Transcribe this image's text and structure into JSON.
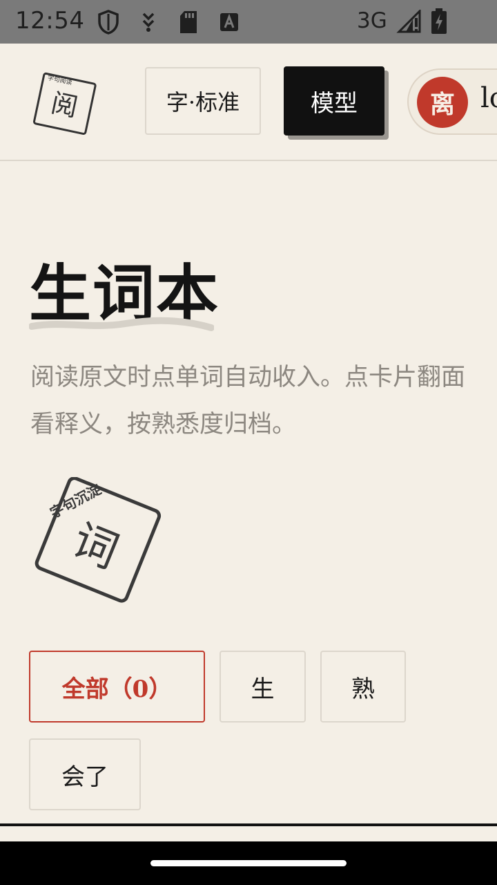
{
  "status_bar": {
    "time": "12:54",
    "network": "3G",
    "icons": [
      "shield-icon",
      "download-icon",
      "sd-card-icon",
      "font-a-icon",
      "signal-icon",
      "battery-charging-icon"
    ]
  },
  "header": {
    "logo_char": "阅",
    "logo_stamp_text": "字句阅读",
    "font_button": "字·标准",
    "model_button": "模型",
    "user": {
      "avatar_char": "离",
      "name": "lo"
    }
  },
  "main": {
    "title": "生词本",
    "subtitle": "阅读原文时点单词自动收入。点卡片翻面看释义，按熟悉度归档。",
    "stamp_char": "词",
    "stamp_text": "字句沉淀",
    "filters": [
      {
        "label": "全部（0）",
        "active": true
      },
      {
        "label": "生",
        "active": false
      },
      {
        "label": "熟",
        "active": false
      },
      {
        "label": "会了",
        "active": false
      }
    ]
  },
  "colors": {
    "background": "#f4efe6",
    "accent": "#c0392b",
    "ink": "#1a1a1a",
    "muted": "#8c8780"
  }
}
